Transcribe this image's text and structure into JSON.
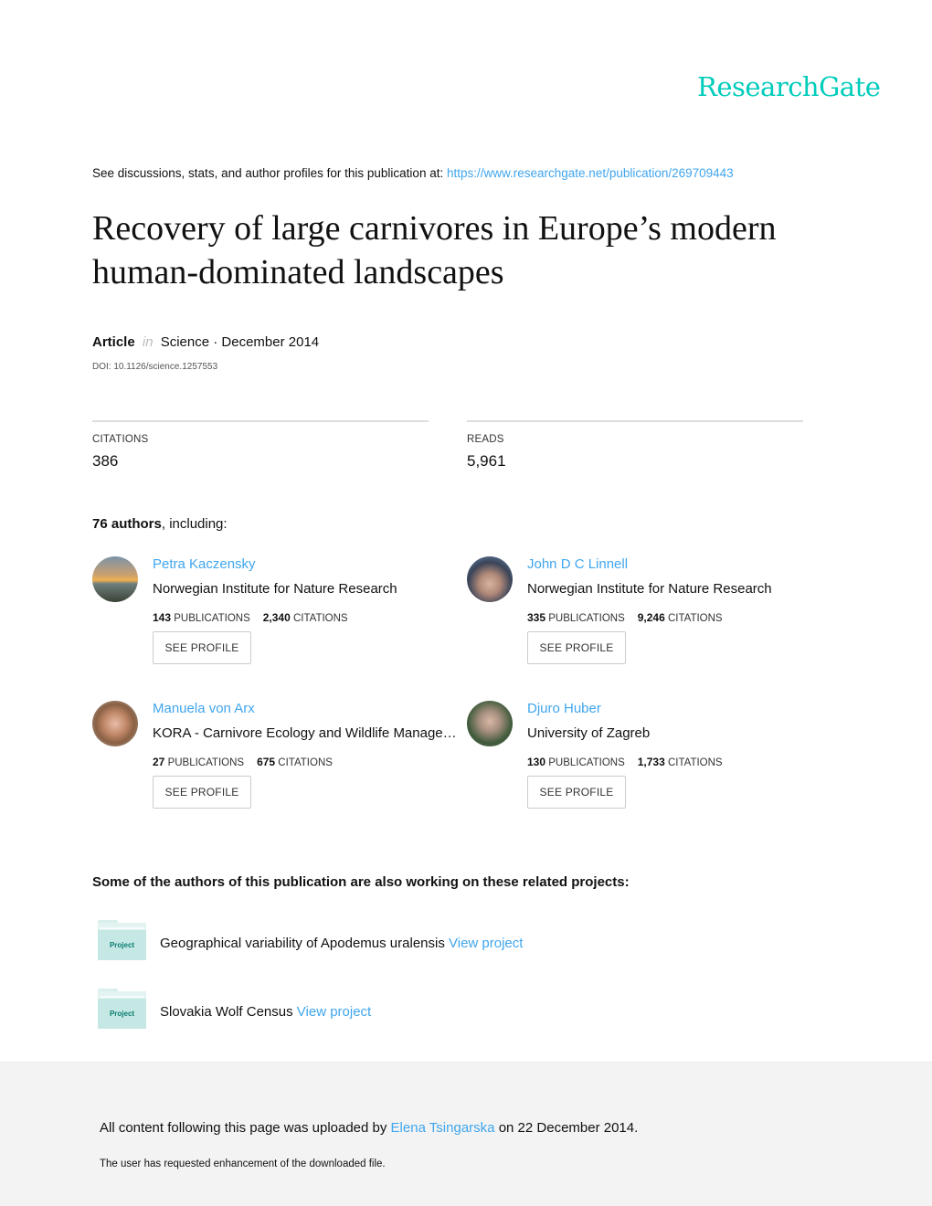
{
  "brand": {
    "logo": "ResearchGate",
    "accent": "#00ccbb",
    "link_color": "#40a6ee"
  },
  "header": {
    "see_discussions": "See discussions, stats, and author profiles for this publication at:",
    "url": "https://www.researchgate.net/publication/269709443"
  },
  "publication": {
    "title": "Recovery of large carnivores in Europe’s modern human-dominated landscapes",
    "type": "Article",
    "in": "in",
    "venue_date": "Science · December 2014",
    "doi": "DOI: 10.1126/science.1257553"
  },
  "stats": {
    "citations_label": "CITATIONS",
    "citations_value": "386",
    "reads_label": "READS",
    "reads_value": "5,961"
  },
  "authors_header": {
    "count": "76 authors",
    "suffix": ", including:"
  },
  "authors": [
    {
      "name": "Petra Kaczensky",
      "institution": "Norwegian Institute for Nature Research",
      "publications": "143",
      "publications_label": "PUBLICATIONS",
      "citations": "2,340",
      "citations_label": "CITATIONS",
      "button": "SEE PROFILE"
    },
    {
      "name": "John D C Linnell",
      "institution": "Norwegian Institute for Nature Research",
      "publications": "335",
      "publications_label": "PUBLICATIONS",
      "citations": "9,246",
      "citations_label": "CITATIONS",
      "button": "SEE PROFILE"
    },
    {
      "name": "Manuela von Arx",
      "institution": "KORA - Carnivore Ecology and Wildlife Manage…",
      "publications": "27",
      "publications_label": "PUBLICATIONS",
      "citations": "675",
      "citations_label": "CITATIONS",
      "button": "SEE PROFILE"
    },
    {
      "name": "Djuro Huber",
      "institution": "University of Zagreb",
      "publications": "130",
      "publications_label": "PUBLICATIONS",
      "citations": "1,733",
      "citations_label": "CITATIONS",
      "button": "SEE PROFILE"
    }
  ],
  "related": {
    "heading": "Some of the authors of this publication are also working on these related projects:",
    "projects": [
      {
        "icon_label": "Project",
        "title": "Geographical variability of Apodemus uralensis",
        "link": "View project"
      },
      {
        "icon_label": "Project",
        "title": "Slovakia Wolf Census",
        "link": "View project"
      }
    ]
  },
  "footer": {
    "uploaded_prefix": "All content following this page was uploaded by",
    "uploader": "Elena Tsingarska",
    "uploaded_suffix": "on 22 December 2014.",
    "note": "The user has requested enhancement of the downloaded file."
  }
}
